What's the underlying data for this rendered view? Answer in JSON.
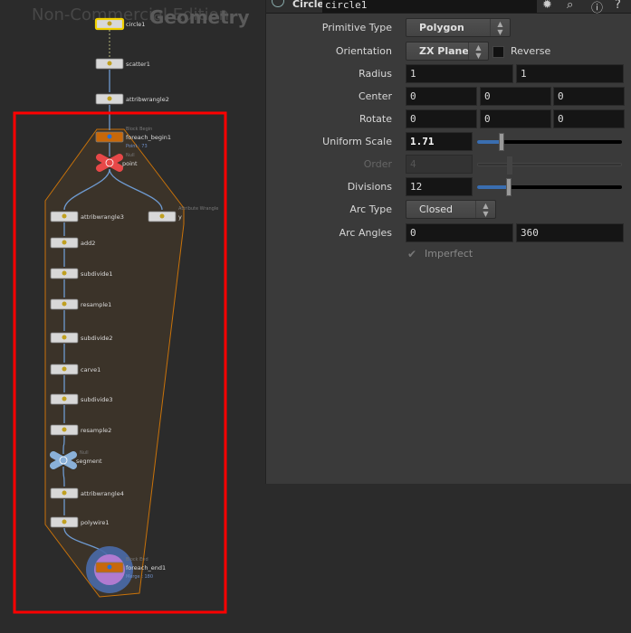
{
  "network": {
    "watermark": "Non-Commercial Edition",
    "context_label": "Geometry",
    "nodes": [
      {
        "name": "circle1"
      },
      {
        "name": "scatter1"
      },
      {
        "name": "attribwrangle2"
      },
      {
        "name": "foreach_begin1",
        "type_label": "Block Begin",
        "info": "Point : 73"
      },
      {
        "name": "point",
        "type_label": "Null"
      },
      {
        "name": "attribwrangle3"
      },
      {
        "name": "y",
        "type_label": "Attribute Wrangle"
      },
      {
        "name": "add2"
      },
      {
        "name": "subdivide1"
      },
      {
        "name": "resample1"
      },
      {
        "name": "subdivide2"
      },
      {
        "name": "carve1"
      },
      {
        "name": "subdivide3"
      },
      {
        "name": "resample2"
      },
      {
        "name": "segment",
        "type_label": "Null"
      },
      {
        "name": "attribwrangle4"
      },
      {
        "name": "polywire1"
      },
      {
        "name": "foreach_end1",
        "type_label": "Block End",
        "info": "Merge : 180"
      }
    ],
    "highlight_color": "#ff0000",
    "block_color": "#c8720a"
  },
  "parameters": {
    "node_type": "Circle",
    "node_name": "circle1",
    "header_icons": [
      "gear-icon",
      "search-icon",
      "info-icon",
      "help-icon"
    ],
    "primitive_type": {
      "label": "Primitive Type",
      "value": "Polygon"
    },
    "orientation": {
      "label": "Orientation",
      "value": "ZX Plane",
      "reverse_label": "Reverse",
      "reverse": false
    },
    "radius": {
      "label": "Radius",
      "values": [
        "1",
        "1"
      ]
    },
    "center": {
      "label": "Center",
      "values": [
        "0",
        "0",
        "0"
      ]
    },
    "rotate": {
      "label": "Rotate",
      "values": [
        "0",
        "0",
        "0"
      ]
    },
    "uniform_scale": {
      "label": "Uniform Scale",
      "value": "1.71",
      "slider_fraction": 0.17
    },
    "order": {
      "label": "Order",
      "value": "4",
      "disabled": true
    },
    "divisions": {
      "label": "Divisions",
      "value": "12",
      "slider_fraction": 0.22
    },
    "arc_type": {
      "label": "Arc Type",
      "value": "Closed"
    },
    "arc_angles": {
      "label": "Arc Angles",
      "values": [
        "0",
        "360"
      ]
    },
    "imperfect": {
      "label": "Imperfect",
      "checked": true,
      "disabled": true
    }
  }
}
